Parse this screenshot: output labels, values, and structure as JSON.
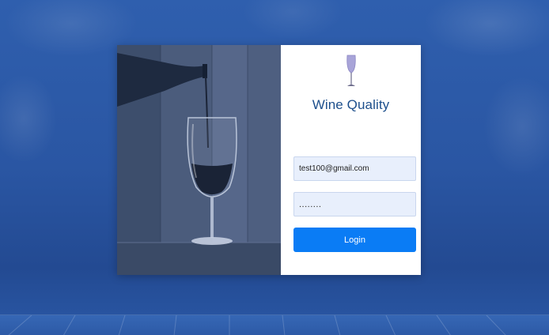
{
  "app": {
    "brand_title": "Wine Quality",
    "logo_icon": "wine-glass-icon",
    "accent_color": "#0a7cf5",
    "brand_color": "#1d4f8c"
  },
  "login_form": {
    "email_value": "test100@gmail.com",
    "password_value": "........",
    "login_label": "Login"
  }
}
